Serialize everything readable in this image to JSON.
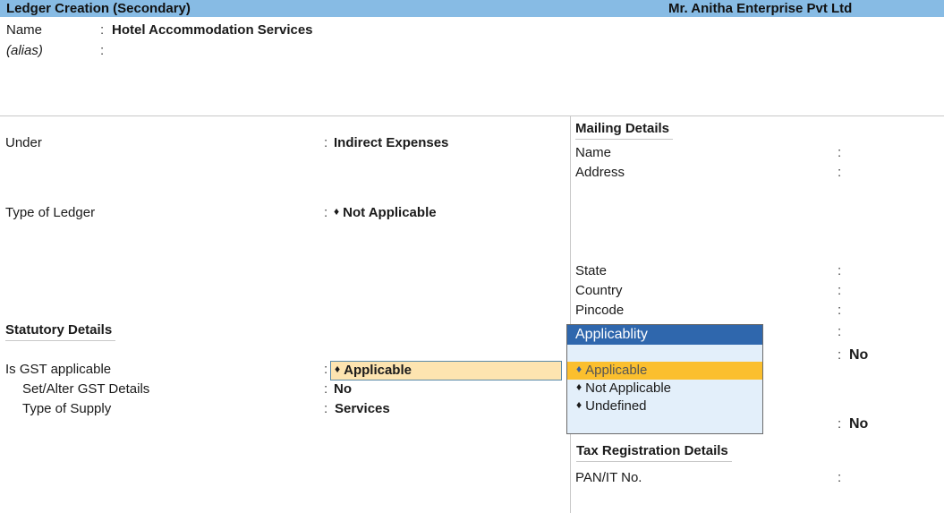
{
  "window": {
    "title": "Ledger Creation (Secondary)",
    "company": "Mr. Anitha Enterprise Pvt Ltd"
  },
  "header_fields": {
    "name_label": "Name",
    "name_value": "Hotel Accommodation Services",
    "alias_label": "(alias)",
    "alias_value": "",
    "colon": ":"
  },
  "left_panel": {
    "under_label": "Under",
    "under_value": "Indirect Expenses",
    "type_of_ledger_label": "Type of Ledger",
    "type_of_ledger_value": "Not Applicable",
    "statutory_heading": "Statutory Details",
    "gst_applicable_label": "Is GST applicable",
    "gst_applicable_value": "Applicable",
    "set_alter_gst_label": "Set/Alter GST Details",
    "set_alter_gst_value": "No",
    "type_of_supply_label": "Type of Supply",
    "type_of_supply_value": "Services"
  },
  "right_panel": {
    "mailing_heading": "Mailing Details",
    "mail_name_label": "Name",
    "address_label": "Address",
    "state_label": "State",
    "country_label": "Country",
    "pincode_label": "Pincode",
    "hidden_value_1": "No",
    "hidden_value_2": "No",
    "tax_heading": "Tax Registration Details",
    "pan_label": "PAN/IT No."
  },
  "popup": {
    "title": "Applicablity",
    "options": [
      {
        "label": "Applicable",
        "selected": true
      },
      {
        "label": "Not Applicable",
        "selected": false
      },
      {
        "label": "Undefined",
        "selected": false
      }
    ],
    "bullet": "♦"
  },
  "colors": {
    "titlebar": "#87bbe4",
    "popup_header": "#2f67ad",
    "popup_bg": "#e3effa",
    "selected_option": "#fbbf2e",
    "active_field": "#fde4b0"
  }
}
